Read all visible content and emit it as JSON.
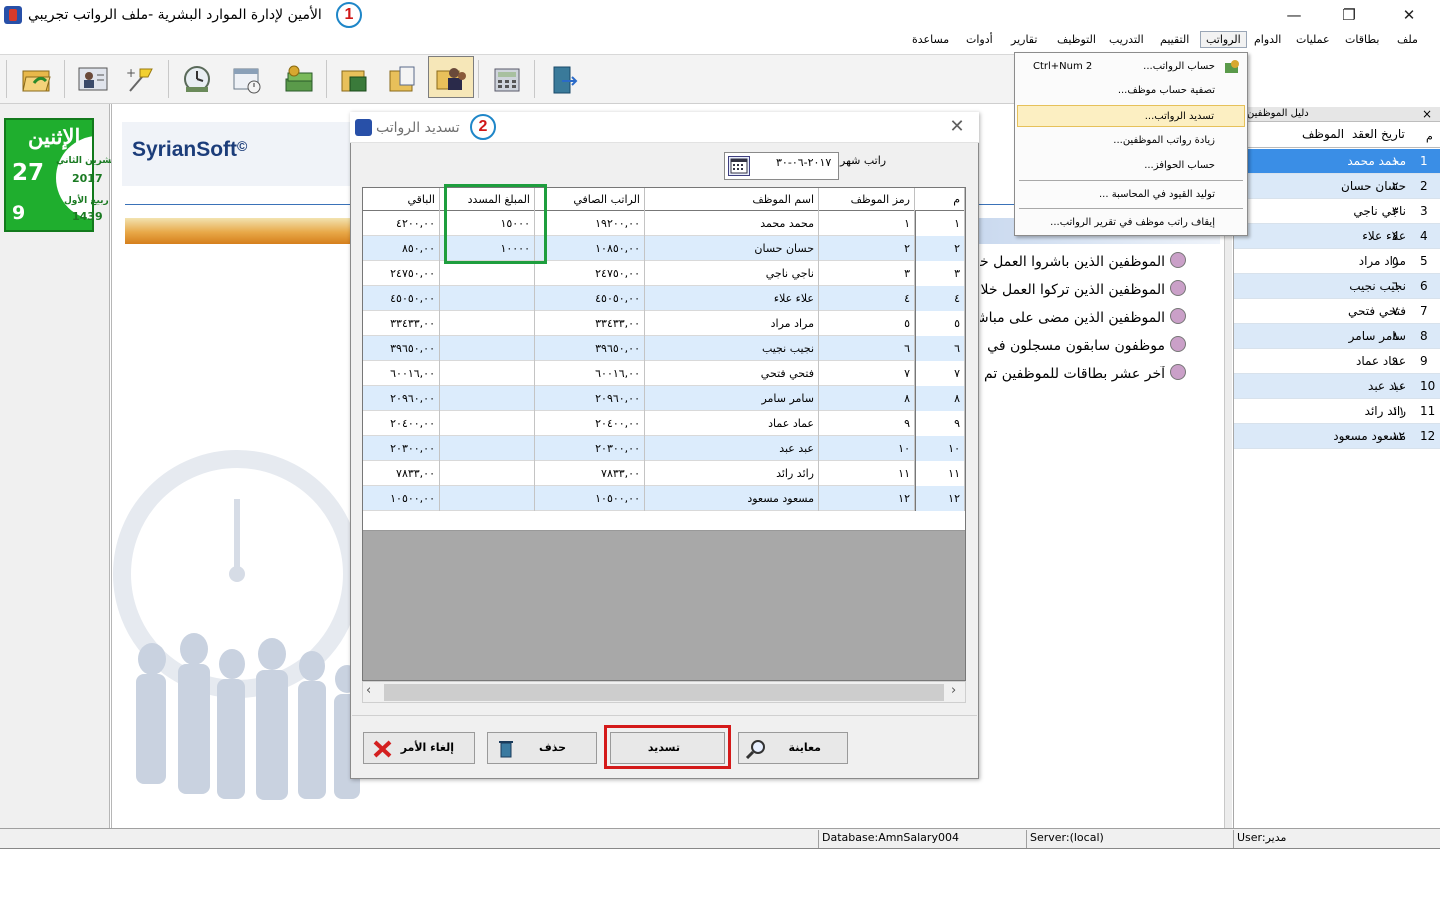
{
  "window": {
    "title": "الأمين لإدارة الموارد البشرية -ملف الرواتب تجريبي",
    "badge_1": "1",
    "minimize_glyph": "—",
    "maximize_glyph": "❐",
    "close_glyph": "✕"
  },
  "menubar": {
    "file": "ملف",
    "cards": "بطاقات",
    "operations": "عمليات",
    "attendance": "الدوام",
    "salaries": "الرواتب",
    "evaluation": "التقييم",
    "training": "التدريب",
    "hiring": "التوظيف",
    "reports": "تقارير",
    "tools": "أدوات",
    "help": "مساعدة"
  },
  "salaries_menu": {
    "items": [
      {
        "label": "حساب الرواتب...",
        "shortcut": "Ctrl+Num 2"
      },
      {
        "label": "تصفية حساب موظف..."
      },
      {
        "label": "تسديد الرواتب..."
      },
      {
        "label": "زيادة رواتب الموظفين..."
      },
      {
        "label": "حساب الحوافز..."
      },
      {
        "label": "توليد القيود في المحاسبة ..."
      },
      {
        "label": "إيقاف راتب موظف في تقرير الرواتب..."
      }
    ],
    "highlighted_index": 2
  },
  "datebox": {
    "day_name": "الإثنين",
    "greg_day": "27",
    "greg_month": "تشرين الثاني",
    "greg_year": "2017",
    "hijri_day": "9",
    "hijri_month": "ربيع الأول",
    "hijri_year": "1439"
  },
  "brand": {
    "name": "SyrianSoft",
    "mark": "©"
  },
  "main_links": [
    "الموظفين الذين باشروا العمل خلال",
    "الموظفين الذين تركوا العمل خلال",
    "الموظفين الذين مضى على مباشرتهم",
    "موظفون سابقون مسجلون في",
    "آخر عشر بطاقات للموظفين تم"
  ],
  "employee_panel": {
    "title": "دليل الموظفين",
    "close_glyph": "×",
    "columns": [
      "م",
      "تاريخ العقد",
      "الموظف"
    ],
    "rows": [
      {
        "n": "1",
        "code": "١",
        "name": "محمد محمد"
      },
      {
        "n": "2",
        "code": "٢",
        "name": "حسان حسان"
      },
      {
        "n": "3",
        "code": "٣",
        "name": "ناجي ناجي"
      },
      {
        "n": "4",
        "code": "٤",
        "name": "علاء علاء"
      },
      {
        "n": "5",
        "code": "٥",
        "name": "مراد مراد"
      },
      {
        "n": "6",
        "code": "٦",
        "name": "نجيب نجيب"
      },
      {
        "n": "7",
        "code": "٧",
        "name": "فتحي فتحي"
      },
      {
        "n": "8",
        "code": "٨",
        "name": "سامر سامر"
      },
      {
        "n": "9",
        "code": "٩",
        "name": "عماد عماد"
      },
      {
        "n": "10",
        "code": "١٠",
        "name": "عبد عبد"
      },
      {
        "n": "11",
        "code": "١١",
        "name": "رائد رائد"
      },
      {
        "n": "12",
        "code": "١٢",
        "name": "مسعود مسعود"
      }
    ]
  },
  "dialog": {
    "title": "تسديد الرواتب",
    "badge_2": "2",
    "close_glyph": "✕",
    "month_label": "راتب شهر",
    "month_value": "٢٠١٧-٠٦-٣٠",
    "columns": {
      "index": "م",
      "code": "رمز الموظف",
      "name": "اسم الموظف",
      "net_salary": "الراتب الصافي",
      "paid": "المبلغ المسدد",
      "remaining": "الباقي"
    },
    "rows": [
      {
        "i": "١",
        "code": "١",
        "name": "محمد محمد",
        "net": "١٩٢٠٠,٠٠",
        "paid": "١٥٠٠٠",
        "rem": "٤٢٠٠,٠٠"
      },
      {
        "i": "٢",
        "code": "٢",
        "name": "حسان حسان",
        "net": "١٠٨٥٠,٠٠",
        "paid": "١٠٠٠٠",
        "rem": "٨٥٠,٠٠"
      },
      {
        "i": "٣",
        "code": "٣",
        "name": "ناجي ناجي",
        "net": "٢٤٧٥٠,٠٠",
        "paid": "",
        "rem": "٢٤٧٥٠,٠٠"
      },
      {
        "i": "٤",
        "code": "٤",
        "name": "علاء علاء",
        "net": "٤٥٠٥٠,٠٠",
        "paid": "",
        "rem": "٤٥٠٥٠,٠٠"
      },
      {
        "i": "٥",
        "code": "٥",
        "name": "مراد مراد",
        "net": "٣٣٤٣٣,٠٠",
        "paid": "",
        "rem": "٣٣٤٣٣,٠٠"
      },
      {
        "i": "٦",
        "code": "٦",
        "name": "نجيب نجيب",
        "net": "٣٩٦٥٠,٠٠",
        "paid": "",
        "rem": "٣٩٦٥٠,٠٠"
      },
      {
        "i": "٧",
        "code": "٧",
        "name": "فتحي فتحي",
        "net": "٦٠٠١٦,٠٠",
        "paid": "",
        "rem": "٦٠٠١٦,٠٠"
      },
      {
        "i": "٨",
        "code": "٨",
        "name": "سامر سامر",
        "net": "٢٠٩٦٠,٠٠",
        "paid": "",
        "rem": "٢٠٩٦٠,٠٠"
      },
      {
        "i": "٩",
        "code": "٩",
        "name": "عماد عماد",
        "net": "٢٠٤٠٠,٠٠",
        "paid": "",
        "rem": "٢٠٤٠٠,٠٠"
      },
      {
        "i": "١٠",
        "code": "١٠",
        "name": "عبد عبد",
        "net": "٢٠٣٠٠,٠٠",
        "paid": "",
        "rem": "٢٠٣٠٠,٠٠"
      },
      {
        "i": "١١",
        "code": "١١",
        "name": "رائد رائد",
        "net": "٧٨٣٣,٠٠",
        "paid": "",
        "rem": "٧٨٣٣,٠٠"
      },
      {
        "i": "١٢",
        "code": "١٢",
        "name": "مسعود مسعود",
        "net": "١٠٥٠٠,٠٠",
        "paid": "",
        "rem": "١٠٥٠٠,٠٠"
      }
    ],
    "buttons": {
      "cancel": "إلغاء الأمر",
      "delete": "حذف",
      "pay": "تسديد",
      "preview": "معاينة"
    }
  },
  "statusbar": {
    "database": "Database:AmnSalary004",
    "server": "Server:(local)",
    "user": "User:مدير"
  },
  "colors": {
    "accent_blue": "#3a8ee6",
    "row_alt": "#dcecfc",
    "highlight_green": "#1e9e3e",
    "highlight_red": "#d41a1a",
    "badge_ring": "#1e86c8",
    "datebox_green": "#1fae2e"
  },
  "icons": {
    "toolbar": [
      "open-folder-icon",
      "employee-card-icon",
      "pin-tool-icon",
      "clock-icon",
      "schedule-icon",
      "money-stack-icon",
      "folder-stack-icon",
      "document-folder-icon",
      "salary-payment-icon",
      "calculator-icon",
      "exit-door-icon"
    ]
  }
}
